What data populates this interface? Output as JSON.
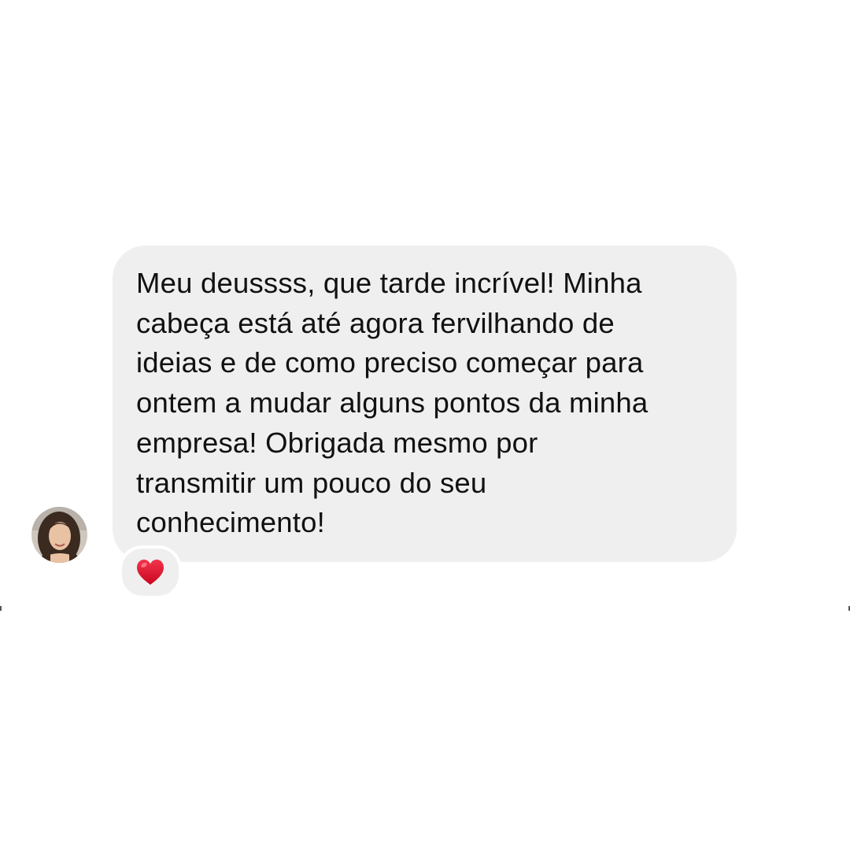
{
  "message": {
    "lines": [
      "Meu deussss, que tarde incrível! Minha",
      "cabeça está até agora fervilhando de",
      "ideias e de como preciso começar para",
      "ontem a mudar alguns pontos da minha",
      "empresa! Obrigada mesmo por",
      "transmitir um pouco do seu",
      "conhecimento!"
    ],
    "bubble_color": "#efefef",
    "text_color": "#111111"
  },
  "sender": {
    "avatar_icon": "profile-photo"
  },
  "reaction": {
    "emoji_icon": "red-heart-icon",
    "color": "#e0102a"
  }
}
